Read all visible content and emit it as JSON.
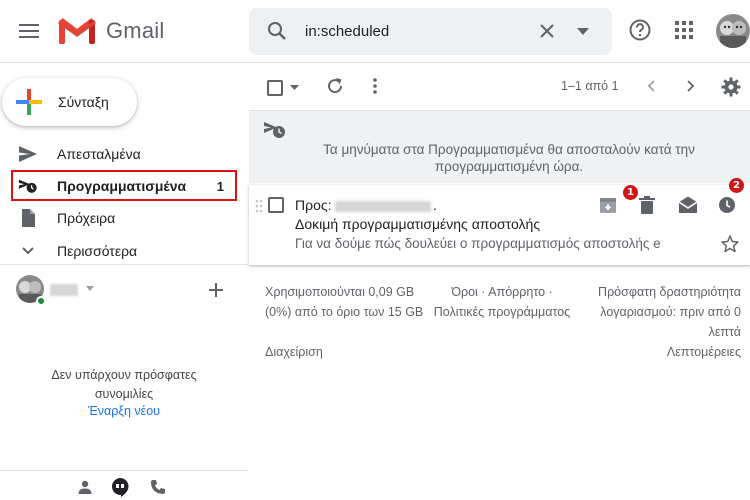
{
  "header": {
    "brand": "Gmail",
    "search": {
      "value": "in:scheduled"
    }
  },
  "sidebar": {
    "compose_label": "Σύνταξη",
    "items": [
      {
        "label": "Απεσταλμένα",
        "count": ""
      },
      {
        "label": "Προγραμματισμένα",
        "count": "1"
      },
      {
        "label": "Πρόχειρα",
        "count": ""
      },
      {
        "label": "Περισσότερα",
        "count": ""
      }
    ],
    "hangouts": {
      "no_conversations": "Δεν υπάρχουν πρόσφατες συνομιλίες",
      "start_new": "Έναρξη νέου"
    }
  },
  "toolbar": {
    "range": "1–1 από 1"
  },
  "banner": {
    "text": "Τα μηνύματα στα Προγραμματισμένα θα αποσταλούν κατά την προγραμματισμένη ώρα."
  },
  "email": {
    "to_label": "Προς:",
    "to_suffix": ".",
    "subject": "Δοκιμή προγραμματισμένης αποστολής",
    "snippet": "Για να δούμε πώς δουλεύει ο προγραμματισμός αποστολής e"
  },
  "annotations": {
    "badge_1": "1",
    "badge_2": "2"
  },
  "footer": {
    "storage": "Χρησιμοποιούνται 0,09 GB (0%) από το όριο των 15 GB",
    "manage": "Διαχείριση",
    "terms": "Όροι · Απόρρητο · Πολιτικές προγράμματος",
    "activity": "Πρόσφατη δραστηριότητα λογαριασμού: πριν από 0 λεπτά",
    "details": "Λεπτομέρειες"
  },
  "colors": {
    "highlight": "#e01010",
    "badge": "#d01616",
    "link": "#1a73e8",
    "online": "#1e8e3e"
  },
  "icons": [
    "menu-icon",
    "gmail-logo-icon",
    "search-icon",
    "clear-icon",
    "dropdown-icon",
    "help-icon",
    "apps-icon",
    "avatar",
    "plus-icon",
    "send-icon",
    "scheduled-icon",
    "draft-icon",
    "chevron-down-icon",
    "refresh-icon",
    "more-vert-icon",
    "chevron-left-icon",
    "chevron-right-icon",
    "gear-icon",
    "archive-icon",
    "trash-icon",
    "mark-read-icon",
    "snooze-icon",
    "star-icon",
    "person-icon",
    "hangouts-icon",
    "phone-icon"
  ]
}
